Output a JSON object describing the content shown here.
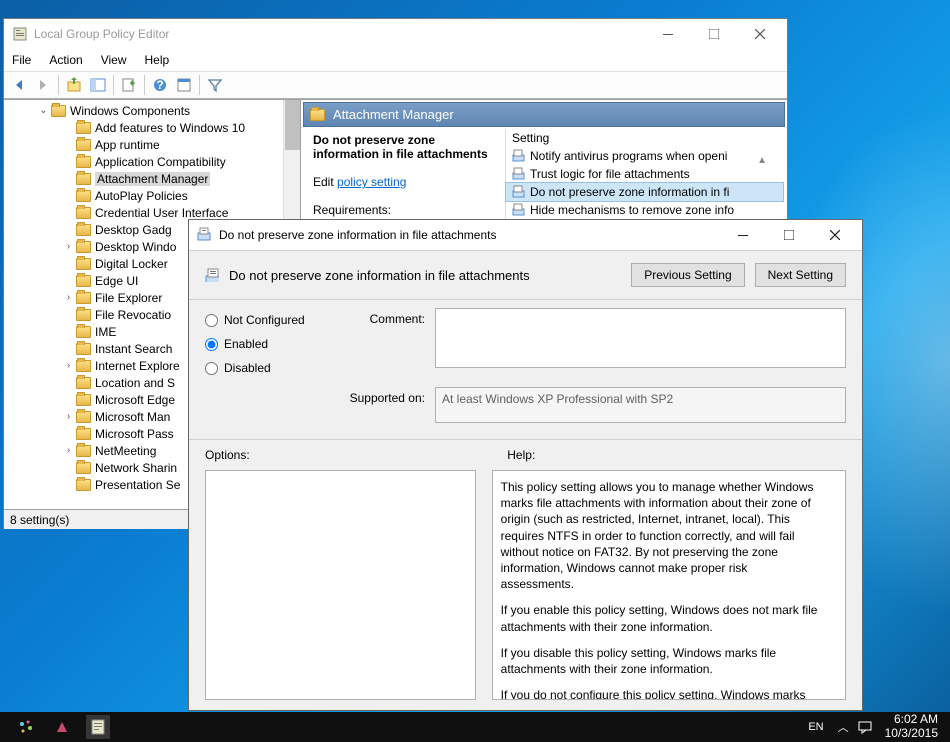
{
  "gpedit": {
    "title": "Local Group Policy Editor",
    "menu": {
      "file": "File",
      "action": "Action",
      "view": "View",
      "help": "Help"
    },
    "tree": {
      "root": "Windows Components",
      "items": [
        "Add features to Windows 10",
        "App runtime",
        "Application Compatibility",
        "Attachment Manager",
        "AutoPlay Policies",
        "Credential User Interface",
        "Desktop Gadg",
        "Desktop Windo",
        "Digital Locker",
        "Edge UI",
        "File Explorer",
        "File Revocatio",
        "IME",
        "Instant Search",
        "Internet Explore",
        "Location and S",
        "Microsoft Edge",
        "Microsoft Man",
        "Microsoft Pass",
        "NetMeeting",
        "Network Sharin",
        "Presentation Se"
      ],
      "expandable": [
        7,
        10,
        14,
        17,
        19
      ],
      "selected": 3
    },
    "detail": {
      "header": "Attachment Manager",
      "selected_title": "Do not preserve zone information in file attachments",
      "edit_label": "Edit",
      "edit_link": "policy setting",
      "requirements_label": "Requirements:",
      "setting_col": "Setting",
      "settings": [
        "Notify antivirus programs when openi",
        "Trust logic for file attachments",
        "Do not preserve zone information in fi",
        "Hide mechanisms to remove zone info"
      ],
      "settings_selected": 2
    },
    "status": "8 setting(s)"
  },
  "policy": {
    "title": "Do not preserve zone information in file attachments",
    "subtitle": "Do not preserve zone information in file attachments",
    "prev_btn": "Previous Setting",
    "next_btn": "Next Setting",
    "radios": {
      "not_configured": "Not Configured",
      "enabled": "Enabled",
      "disabled": "Disabled"
    },
    "comment_label": "Comment:",
    "comment_value": "",
    "supported_label": "Supported on:",
    "supported_value": "At least Windows XP Professional with SP2",
    "options_label": "Options:",
    "help_label": "Help:",
    "help_p1": "This policy setting allows you to manage whether Windows marks file attachments with information about their zone of origin (such as restricted, Internet, intranet, local). This requires NTFS in order to function correctly, and will fail without notice on FAT32. By not preserving the zone information, Windows cannot make proper risk assessments.",
    "help_p2": "If you enable this policy setting, Windows does not mark file attachments with their zone information.",
    "help_p3": "If you disable this policy setting, Windows marks file attachments with their zone information.",
    "help_p4": "If you do not configure this policy setting, Windows marks file attachments with their zone information."
  },
  "taskbar": {
    "lang": "EN",
    "time": "6:02 AM",
    "date": "10/3/2015"
  }
}
